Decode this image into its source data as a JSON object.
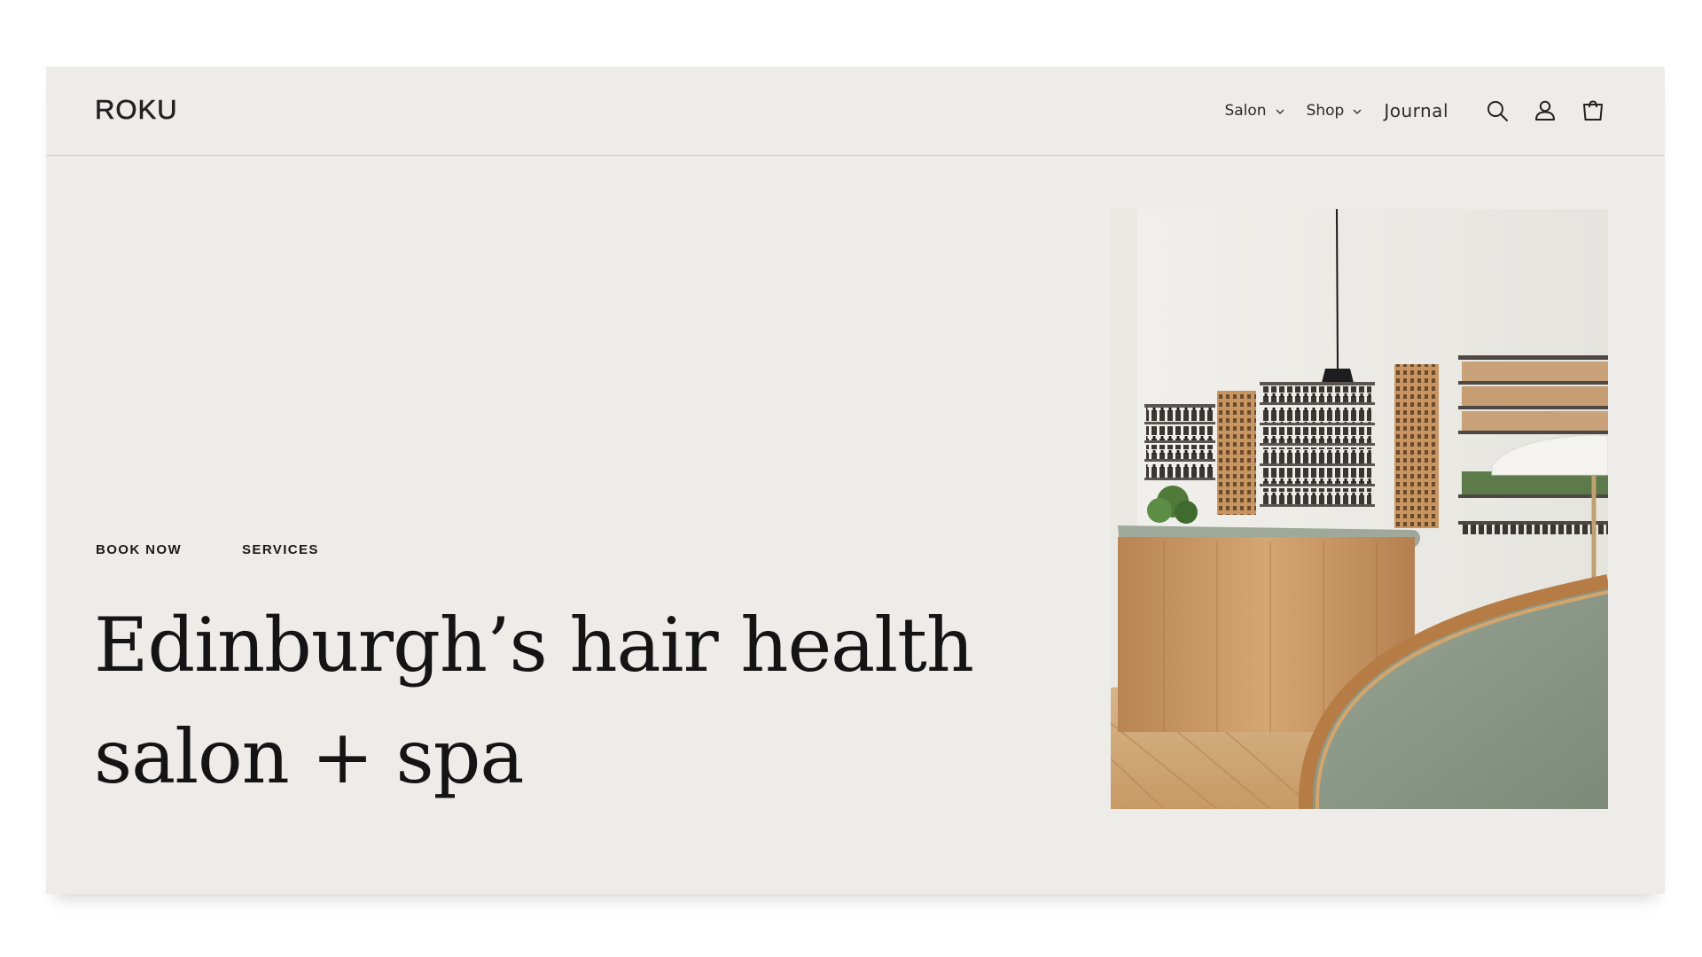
{
  "header": {
    "logo": "ROKU",
    "nav": {
      "salon_label": "Salon",
      "shop_label": "Shop",
      "journal_label": "Journal"
    },
    "icons": [
      "search-icon",
      "account-icon",
      "cart-icon"
    ]
  },
  "hero": {
    "links": {
      "book_now": "BOOK NOW",
      "services": "SERVICES"
    },
    "headline_line1": "Edinburgh’s hair health",
    "headline_line2": "salon + spa"
  },
  "colors": {
    "background": "#edece8",
    "text": "#141414",
    "wood": "#c99a63",
    "marble": "#8c9a86"
  }
}
